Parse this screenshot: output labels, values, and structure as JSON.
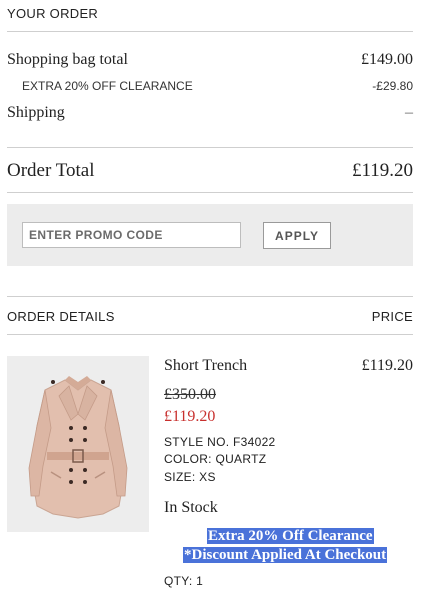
{
  "summary": {
    "heading": "YOUR ORDER",
    "bag_total_label": "Shopping bag total",
    "bag_total_value": "£149.00",
    "discount_label": "EXTRA 20% OFF CLEARANCE",
    "discount_value": "-£29.80",
    "shipping_label": "Shipping",
    "shipping_value": "–",
    "order_total_label": "Order Total",
    "order_total_value": "£119.20"
  },
  "promo": {
    "placeholder": "ENTER PROMO CODE",
    "apply_label": "APPLY"
  },
  "details": {
    "heading": "ORDER DETAILS",
    "price_heading": "PRICE"
  },
  "item": {
    "name": "Short Trench",
    "price": "£119.20",
    "original_price": "£350.00",
    "sale_price": "£119.20",
    "style_no": "STYLE NO. F34022",
    "color": "COLOR: QUARTZ",
    "size": "SIZE: XS",
    "stock": "In Stock",
    "promo_line1": "Extra 20% Off Clearance",
    "promo_line2": "*Discount Applied At Checkout",
    "qty": "QTY: 1",
    "image_icon": "trench-coat-image"
  },
  "colors": {
    "sale_red": "#c8302e",
    "highlight_blue": "#4a72d9",
    "coat_pink": "#e2bfae"
  }
}
